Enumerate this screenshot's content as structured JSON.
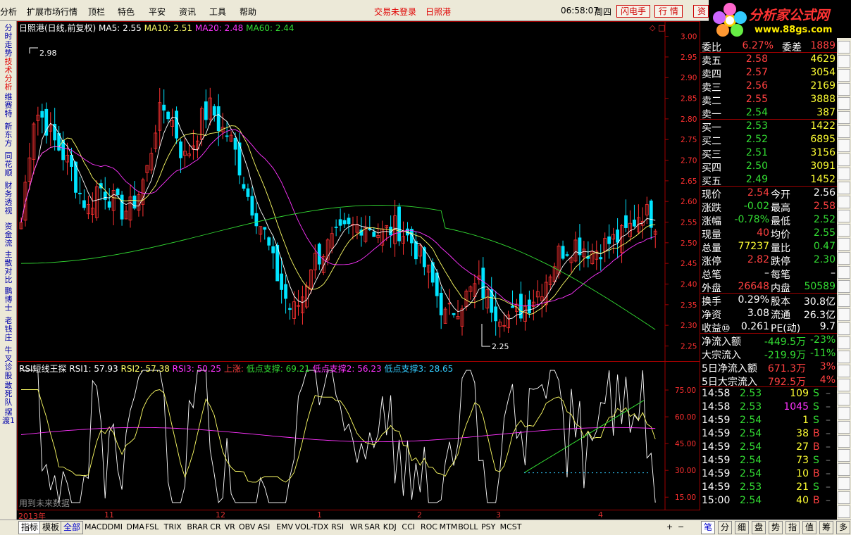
{
  "menu": [
    "分析",
    "扩展市场行情",
    "资讯",
    "顶栏",
    "特色",
    "平安",
    "资讯",
    "工具",
    "帮助"
  ],
  "menu_items": [
    {
      "label": "分析"
    },
    {
      "label": "扩展市场行情"
    },
    {
      "label": "顶栏"
    },
    {
      "label": "特色"
    },
    {
      "label": "平安"
    },
    {
      "label": "资讯"
    },
    {
      "label": "工具"
    },
    {
      "label": "帮助"
    }
  ],
  "status": {
    "login": "交易未登录",
    "stock": "日照港",
    "time": "06:58:07",
    "weekday": "周四"
  },
  "top_buttons": [
    "闪电手",
    "行 情",
    "资"
  ],
  "logo": {
    "text": "分析家公式网",
    "url": "www.88gs.com"
  },
  "left_tabs": [
    "分时走势",
    "技术分析",
    "维赛特",
    "新东方",
    "同花顺",
    "财务透视",
    "资金流",
    "主散对比",
    "鹏博士",
    "老钱庄",
    "牛叉诊股",
    "敢死队",
    "摆渡1"
  ],
  "main_legend": {
    "title": "日照港(日线,前复权)",
    "ma5": "MA5: 2.55",
    "ma10": "MA10: 2.51",
    "ma20": "MA20: 2.48",
    "ma60": "MA60: 2.44"
  },
  "main_annotations": {
    "high": "2.98",
    "low": "2.25"
  },
  "price_ticks": [
    "3.00",
    "2.95",
    "2.90",
    "2.85",
    "2.80",
    "2.75",
    "2.70",
    "2.65",
    "2.60",
    "2.55",
    "2.50",
    "2.45",
    "2.40",
    "2.35",
    "2.30",
    "2.25"
  ],
  "rsi_legend": {
    "title": "RSI短线王探",
    "rsi1": "RSI1: 57.93",
    "rsi2": "RSI2: 57.38",
    "rsi3": "RSI3: 50.25",
    "up": "上涨:",
    "d1": "低点支撑: 69.21",
    "d2": "低点支撑2: 56.23",
    "d3": "低点支撑3: 28.65"
  },
  "rsi_ticks": [
    "75.00",
    "60.00",
    "45.00",
    "30.00",
    "15.00"
  ],
  "rsi_note": "用到未来数据",
  "date_axis": [
    "2013年",
    "11",
    "12",
    "1",
    "2",
    "3",
    "4"
  ],
  "period": "日线",
  "colors": {
    "up": "#ff3232",
    "down": "#00e4ff",
    "ma5": "#ffffff",
    "ma10": "#ffff66",
    "ma20": "#ff33ff",
    "ma60": "#33dd33",
    "grid": "#a00000"
  },
  "quote": {
    "weibi": {
      "label": "委比",
      "value": "6.27%",
      "label2": "委差",
      "value2": "1889"
    },
    "asks": [
      {
        "label": "卖五",
        "price": "2.58",
        "vol": "4629"
      },
      {
        "label": "卖四",
        "price": "2.57",
        "vol": "3054"
      },
      {
        "label": "卖三",
        "price": "2.56",
        "vol": "2169"
      },
      {
        "label": "卖二",
        "price": "2.55",
        "vol": "3888"
      },
      {
        "label": "卖一",
        "price": "2.54",
        "vol": "387"
      }
    ],
    "bids": [
      {
        "label": "买一",
        "price": "2.53",
        "vol": "1422"
      },
      {
        "label": "买二",
        "price": "2.52",
        "vol": "6895"
      },
      {
        "label": "买三",
        "price": "2.51",
        "vol": "3156"
      },
      {
        "label": "买四",
        "price": "2.50",
        "vol": "3091"
      },
      {
        "label": "买五",
        "price": "2.49",
        "vol": "1452"
      }
    ],
    "stats": [
      {
        "l1": "现价",
        "v1": "2.54",
        "c1": "#ff4040",
        "l2": "今开",
        "v2": "2.56",
        "c2": "#ffffff"
      },
      {
        "l1": "涨跌",
        "v1": "-0.02",
        "c1": "#33dd33",
        "l2": "最高",
        "v2": "2.58",
        "c2": "#ff4040"
      },
      {
        "l1": "涨幅",
        "v1": "-0.78%",
        "c1": "#33dd33",
        "l2": "最低",
        "v2": "2.52",
        "c2": "#33dd33"
      },
      {
        "l1": "现量",
        "v1": "40",
        "c1": "#ff4040",
        "l2": "均价",
        "v2": "2.55",
        "c2": "#33dd33"
      },
      {
        "l1": "总量",
        "v1": "77237",
        "c1": "#ffff33",
        "l2": "量比",
        "v2": "0.47",
        "c2": "#33dd33"
      },
      {
        "l1": "涨停",
        "v1": "2.82",
        "c1": "#ff4040",
        "l2": "跌停",
        "v2": "2.30",
        "c2": "#33dd33"
      },
      {
        "l1": "总笔",
        "v1": "–",
        "c1": "#ffffff",
        "l2": "每笔",
        "v2": "–",
        "c2": "#ffffff"
      },
      {
        "l1": "外盘",
        "v1": "26648",
        "c1": "#ff4040",
        "l2": "内盘",
        "v2": "50589",
        "c2": "#33dd33"
      }
    ],
    "stats2": [
      {
        "l1": "换手",
        "v1": "0.29%",
        "l2": "股本",
        "v2": "30.8亿"
      },
      {
        "l1": "净资",
        "v1": "3.08",
        "l2": "流通",
        "v2": "26.3亿"
      },
      {
        "l1": "收益⑩",
        "v1": "0.261",
        "l2": "PE(动)",
        "v2": "9.7"
      }
    ],
    "flows": [
      {
        "label": "净流入额",
        "v1": "-449.5万",
        "v2": "-23%",
        "color": "#33dd33"
      },
      {
        "label": "大宗流入",
        "v1": "-219.9万",
        "v2": "-11%",
        "color": "#33dd33"
      },
      {
        "label": "5日净流入额",
        "v1": "671.3万",
        "v2": "3%",
        "color": "#ff4040"
      },
      {
        "label": "5日大宗流入",
        "v1": "792.5万",
        "v2": "4%",
        "color": "#ff4040"
      }
    ],
    "ticks": [
      {
        "t": "14:58",
        "p": "2.53",
        "v": "109",
        "bs": "S",
        "vc": "#ffff33"
      },
      {
        "t": "14:58",
        "p": "2.53",
        "v": "1045",
        "bs": "S",
        "vc": "#ff33ff"
      },
      {
        "t": "14:59",
        "p": "2.54",
        "v": "1",
        "bs": "S",
        "vc": "#ffff33"
      },
      {
        "t": "14:59",
        "p": "2.54",
        "v": "38",
        "bs": "B",
        "vc": "#ffff33"
      },
      {
        "t": "14:59",
        "p": "2.54",
        "v": "27",
        "bs": "B",
        "vc": "#ffff33"
      },
      {
        "t": "14:59",
        "p": "2.54",
        "v": "73",
        "bs": "S",
        "vc": "#ffff33"
      },
      {
        "t": "14:59",
        "p": "2.54",
        "v": "10",
        "bs": "B",
        "vc": "#ffff33"
      },
      {
        "t": "14:59",
        "p": "2.53",
        "v": "21",
        "bs": "S",
        "vc": "#ffff33"
      },
      {
        "t": "15:00",
        "p": "2.54",
        "v": "40",
        "bs": "B",
        "vc": "#ffff33"
      }
    ]
  },
  "bottom": {
    "tabs": [
      "指标",
      "模板",
      "全部"
    ],
    "indicators": [
      "MACD",
      "DMI",
      "DMA",
      "FSL",
      "TRIX",
      "BRAR",
      "CR",
      "VR",
      "OBV",
      "ASI",
      "EMV",
      "VOL-TDX",
      "RSI",
      "WR",
      "SAR",
      "KDJ",
      "CCI",
      "ROC",
      "MTM",
      "BOLL",
      "PSY",
      "MCST"
    ],
    "right_tabs": [
      "笔",
      "分",
      "细",
      "盘",
      "势",
      "指",
      "值",
      "筹",
      "多"
    ]
  }
}
